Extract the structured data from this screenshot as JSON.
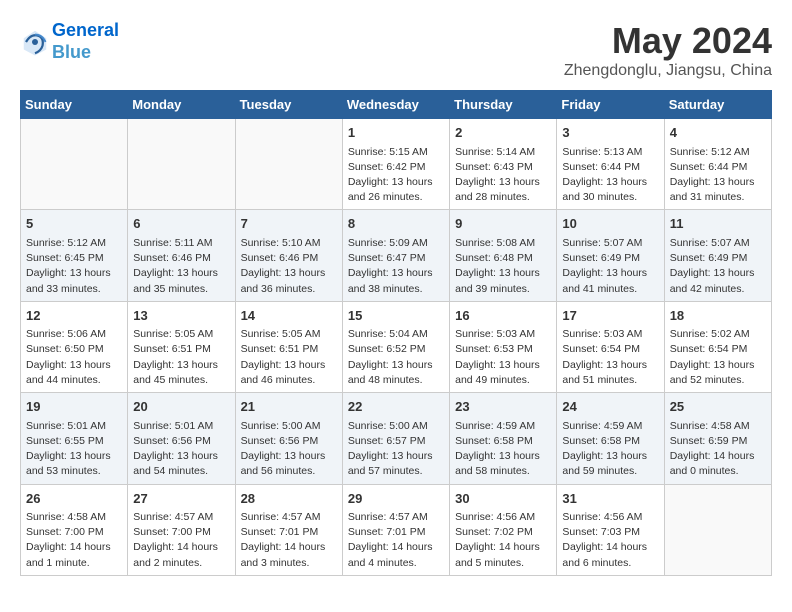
{
  "header": {
    "logo_line1": "General",
    "logo_line2": "Blue",
    "month_year": "May 2024",
    "location": "Zhengdonglu, Jiangsu, China"
  },
  "days_of_week": [
    "Sunday",
    "Monday",
    "Tuesday",
    "Wednesday",
    "Thursday",
    "Friday",
    "Saturday"
  ],
  "weeks": [
    [
      {
        "day": "",
        "content": ""
      },
      {
        "day": "",
        "content": ""
      },
      {
        "day": "",
        "content": ""
      },
      {
        "day": "1",
        "content": "Sunrise: 5:15 AM\nSunset: 6:42 PM\nDaylight: 13 hours\nand 26 minutes."
      },
      {
        "day": "2",
        "content": "Sunrise: 5:14 AM\nSunset: 6:43 PM\nDaylight: 13 hours\nand 28 minutes."
      },
      {
        "day": "3",
        "content": "Sunrise: 5:13 AM\nSunset: 6:44 PM\nDaylight: 13 hours\nand 30 minutes."
      },
      {
        "day": "4",
        "content": "Sunrise: 5:12 AM\nSunset: 6:44 PM\nDaylight: 13 hours\nand 31 minutes."
      }
    ],
    [
      {
        "day": "5",
        "content": "Sunrise: 5:12 AM\nSunset: 6:45 PM\nDaylight: 13 hours\nand 33 minutes."
      },
      {
        "day": "6",
        "content": "Sunrise: 5:11 AM\nSunset: 6:46 PM\nDaylight: 13 hours\nand 35 minutes."
      },
      {
        "day": "7",
        "content": "Sunrise: 5:10 AM\nSunset: 6:46 PM\nDaylight: 13 hours\nand 36 minutes."
      },
      {
        "day": "8",
        "content": "Sunrise: 5:09 AM\nSunset: 6:47 PM\nDaylight: 13 hours\nand 38 minutes."
      },
      {
        "day": "9",
        "content": "Sunrise: 5:08 AM\nSunset: 6:48 PM\nDaylight: 13 hours\nand 39 minutes."
      },
      {
        "day": "10",
        "content": "Sunrise: 5:07 AM\nSunset: 6:49 PM\nDaylight: 13 hours\nand 41 minutes."
      },
      {
        "day": "11",
        "content": "Sunrise: 5:07 AM\nSunset: 6:49 PM\nDaylight: 13 hours\nand 42 minutes."
      }
    ],
    [
      {
        "day": "12",
        "content": "Sunrise: 5:06 AM\nSunset: 6:50 PM\nDaylight: 13 hours\nand 44 minutes."
      },
      {
        "day": "13",
        "content": "Sunrise: 5:05 AM\nSunset: 6:51 PM\nDaylight: 13 hours\nand 45 minutes."
      },
      {
        "day": "14",
        "content": "Sunrise: 5:05 AM\nSunset: 6:51 PM\nDaylight: 13 hours\nand 46 minutes."
      },
      {
        "day": "15",
        "content": "Sunrise: 5:04 AM\nSunset: 6:52 PM\nDaylight: 13 hours\nand 48 minutes."
      },
      {
        "day": "16",
        "content": "Sunrise: 5:03 AM\nSunset: 6:53 PM\nDaylight: 13 hours\nand 49 minutes."
      },
      {
        "day": "17",
        "content": "Sunrise: 5:03 AM\nSunset: 6:54 PM\nDaylight: 13 hours\nand 51 minutes."
      },
      {
        "day": "18",
        "content": "Sunrise: 5:02 AM\nSunset: 6:54 PM\nDaylight: 13 hours\nand 52 minutes."
      }
    ],
    [
      {
        "day": "19",
        "content": "Sunrise: 5:01 AM\nSunset: 6:55 PM\nDaylight: 13 hours\nand 53 minutes."
      },
      {
        "day": "20",
        "content": "Sunrise: 5:01 AM\nSunset: 6:56 PM\nDaylight: 13 hours\nand 54 minutes."
      },
      {
        "day": "21",
        "content": "Sunrise: 5:00 AM\nSunset: 6:56 PM\nDaylight: 13 hours\nand 56 minutes."
      },
      {
        "day": "22",
        "content": "Sunrise: 5:00 AM\nSunset: 6:57 PM\nDaylight: 13 hours\nand 57 minutes."
      },
      {
        "day": "23",
        "content": "Sunrise: 4:59 AM\nSunset: 6:58 PM\nDaylight: 13 hours\nand 58 minutes."
      },
      {
        "day": "24",
        "content": "Sunrise: 4:59 AM\nSunset: 6:58 PM\nDaylight: 13 hours\nand 59 minutes."
      },
      {
        "day": "25",
        "content": "Sunrise: 4:58 AM\nSunset: 6:59 PM\nDaylight: 14 hours\nand 0 minutes."
      }
    ],
    [
      {
        "day": "26",
        "content": "Sunrise: 4:58 AM\nSunset: 7:00 PM\nDaylight: 14 hours\nand 1 minute."
      },
      {
        "day": "27",
        "content": "Sunrise: 4:57 AM\nSunset: 7:00 PM\nDaylight: 14 hours\nand 2 minutes."
      },
      {
        "day": "28",
        "content": "Sunrise: 4:57 AM\nSunset: 7:01 PM\nDaylight: 14 hours\nand 3 minutes."
      },
      {
        "day": "29",
        "content": "Sunrise: 4:57 AM\nSunset: 7:01 PM\nDaylight: 14 hours\nand 4 minutes."
      },
      {
        "day": "30",
        "content": "Sunrise: 4:56 AM\nSunset: 7:02 PM\nDaylight: 14 hours\nand 5 minutes."
      },
      {
        "day": "31",
        "content": "Sunrise: 4:56 AM\nSunset: 7:03 PM\nDaylight: 14 hours\nand 6 minutes."
      },
      {
        "day": "",
        "content": ""
      }
    ]
  ]
}
